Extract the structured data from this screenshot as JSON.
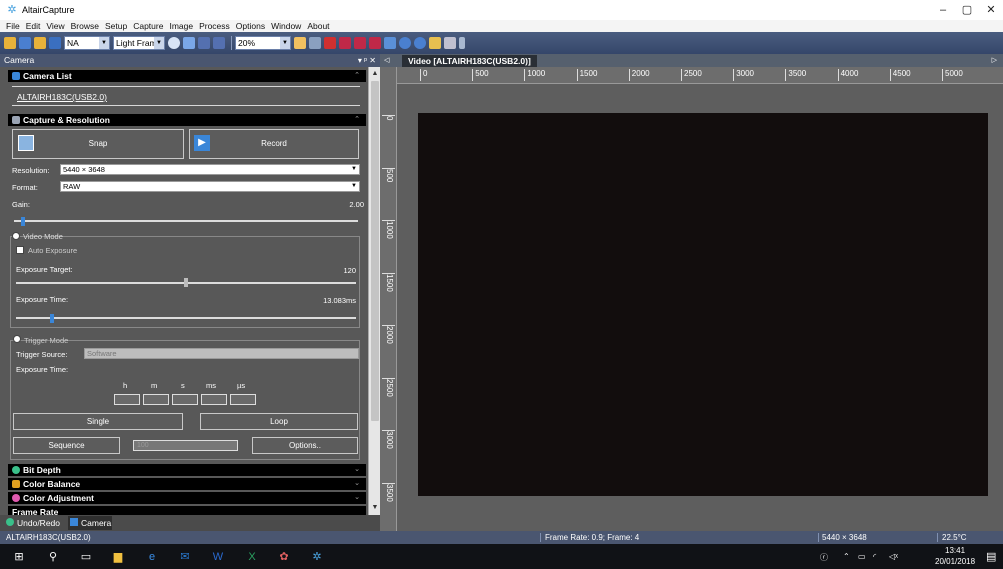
{
  "window": {
    "title": "AltairCapture",
    "controls": [
      "–",
      "▢",
      "✕"
    ]
  },
  "menu": [
    "File",
    "Edit",
    "View",
    "Browse",
    "Setup",
    "Capture",
    "Image",
    "Process",
    "Options",
    "Window",
    "About"
  ],
  "toolbar": {
    "camera_name": "NA",
    "frame_type": "Light Frame",
    "zoom": "20%"
  },
  "camera_panel": {
    "title": "Camera",
    "header_controls": "▾ ᵖ ✕",
    "camera_list_title": "Camera List",
    "camera_name": "ALTAIRH183C(USB2.0)",
    "capture_title": "Capture & Resolution",
    "snap_label": "Snap",
    "record_label": "Record",
    "resolution_label": "Resolution:",
    "resolution_value": "5440 × 3648",
    "format_label": "Format:",
    "format_value": "RAW",
    "gain_label": "Gain:",
    "gain_value": "2.00",
    "gain_level": 0.02,
    "video_mode_label": "Video Mode",
    "auto_exposure_label": "Auto Exposure",
    "exposure_target_label": "Exposure Target:",
    "exposure_target_value": "120",
    "exposure_target_level": 0.5,
    "exposure_time_label": "Exposure Time:",
    "exposure_time_value": "13.083ms",
    "exposure_time_level": 0.1,
    "trigger_mode_label": "Trigger Mode",
    "trigger_source_label": "Trigger Source:",
    "trigger_source_value": "Software",
    "trigger_exposure_label": "Exposure Time:",
    "time_units": [
      "h",
      "m",
      "s",
      "ms",
      "µs"
    ],
    "single_label": "Single",
    "loop_label": "Loop",
    "sequence_label": "Sequence",
    "sequence_value": "100",
    "options_label": "Options..",
    "sections": [
      "Bit Depth",
      "Color Balance",
      "Color Adjustment",
      "Frame Rate"
    ]
  },
  "bottom_tabs": [
    "Undo/Redo",
    "Camera"
  ],
  "document": {
    "tab_label": "Video [ALTAIRH183C(USB2.0)]"
  },
  "ruler": {
    "top": [
      "0",
      "500",
      "1000",
      "1500",
      "2000",
      "2500",
      "3000",
      "3500",
      "4000",
      "4500",
      "5000"
    ],
    "left": [
      "0",
      "500",
      "1000",
      "1500",
      "2000",
      "2500",
      "3000",
      "3500"
    ]
  },
  "status": {
    "camera": "ALTAIRH183C(USB2.0)",
    "frame_info": "Frame Rate: 0.9; Frame: 4",
    "resolution": "5440 × 3648",
    "temperature": "22.5°C"
  },
  "taskbar": {
    "time": "13:41",
    "date": "20/01/2018"
  }
}
